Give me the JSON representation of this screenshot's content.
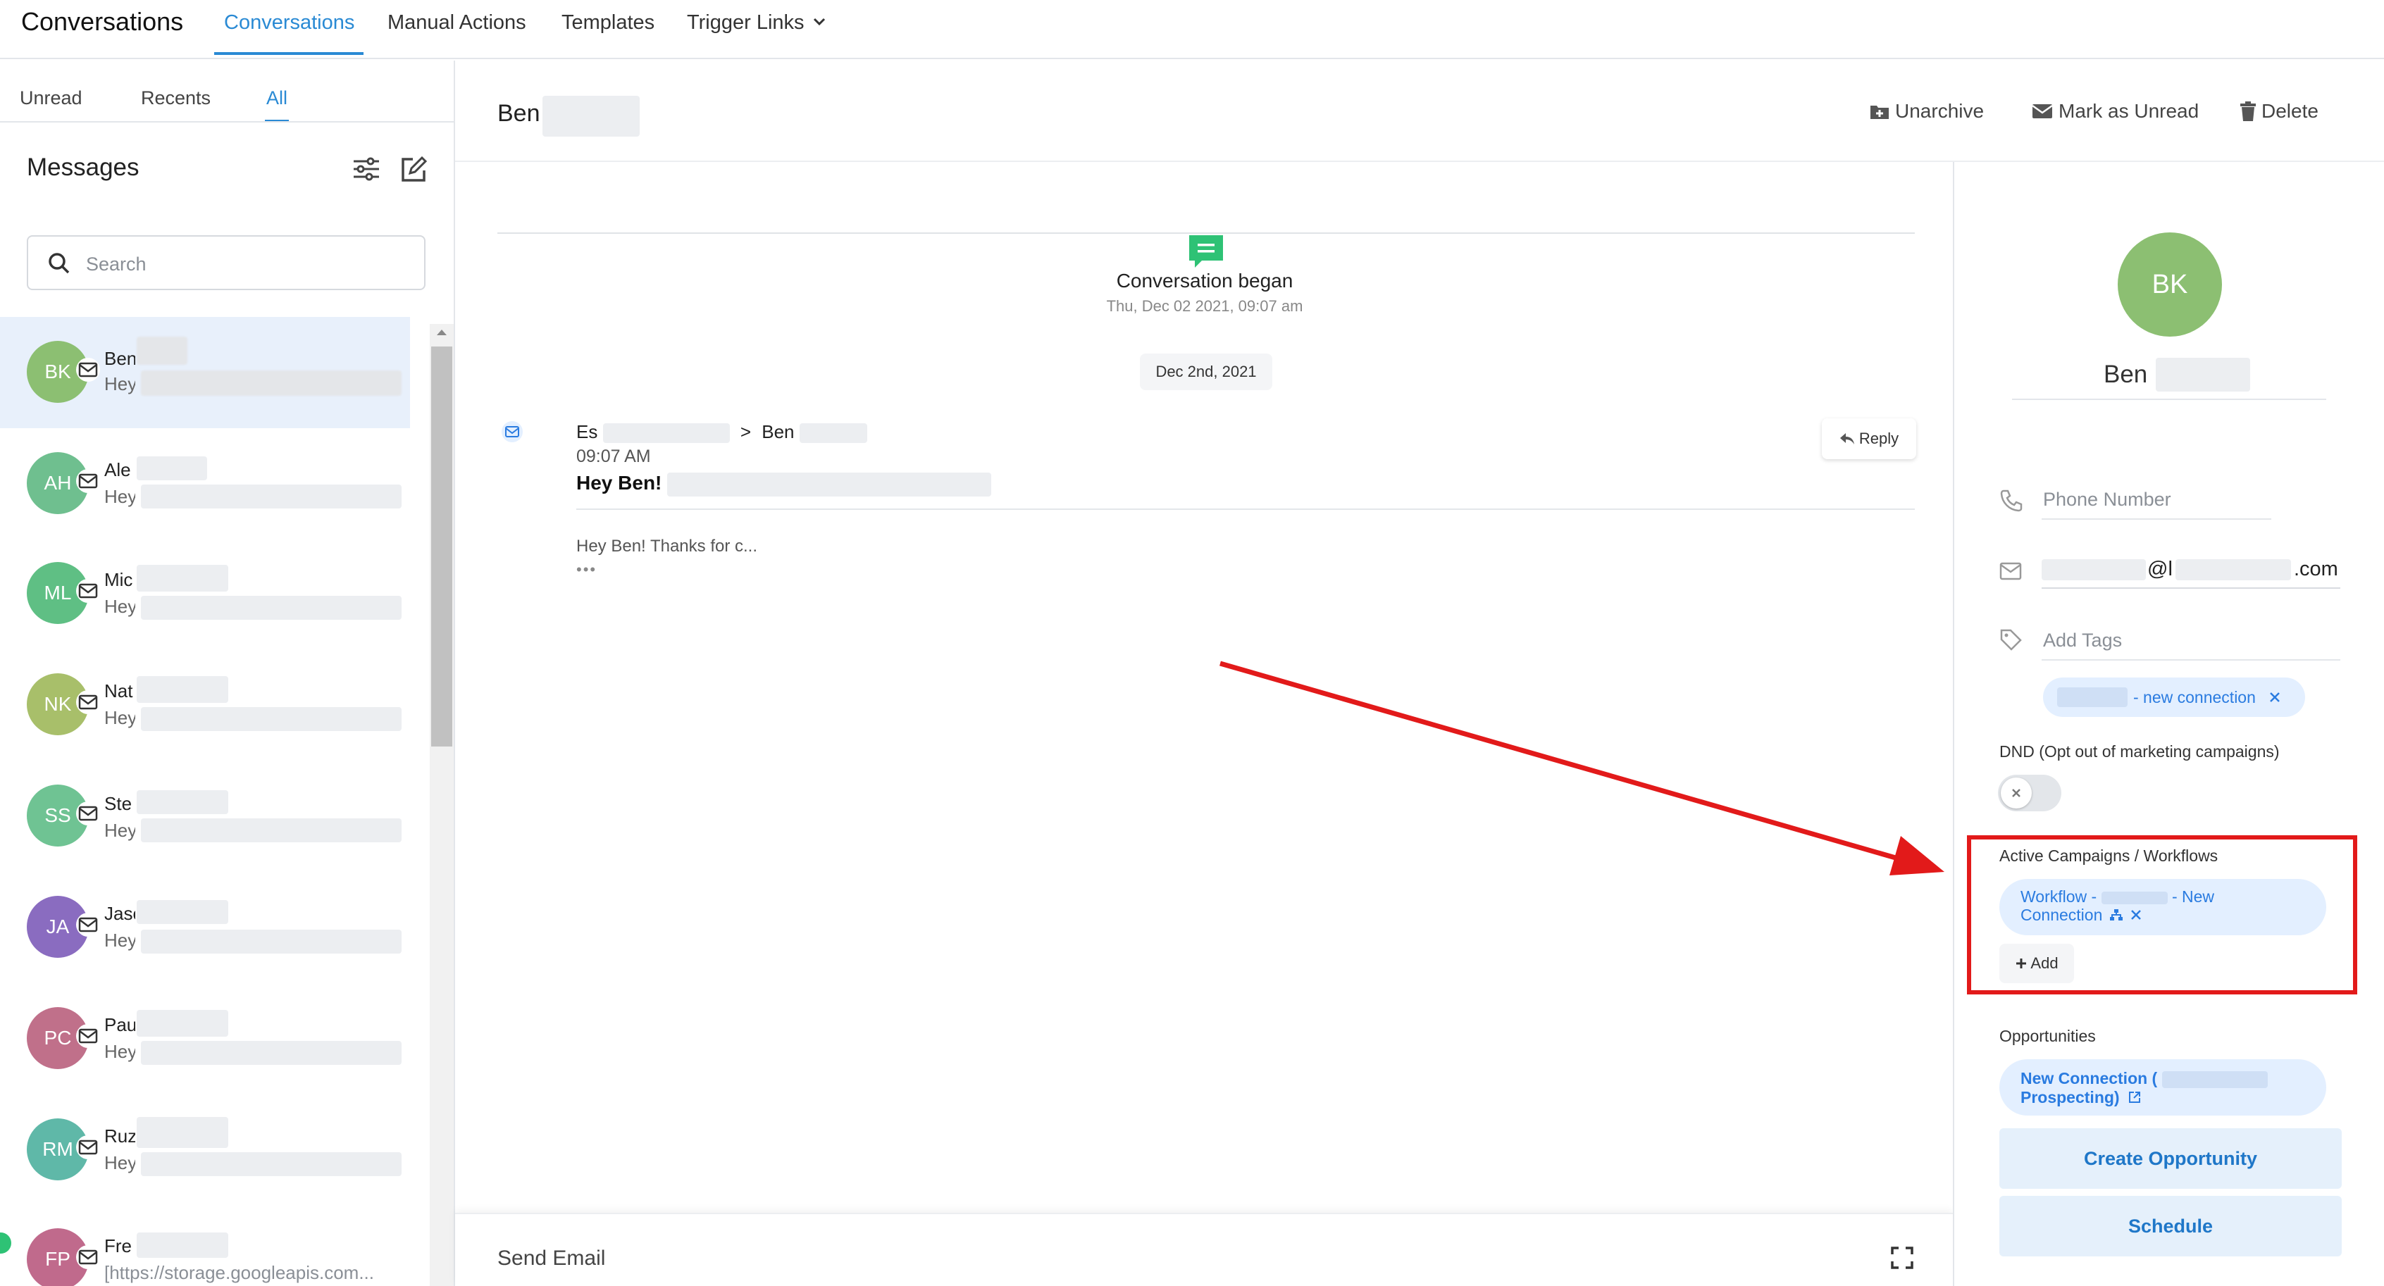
{
  "top_nav": {
    "app_title": "Conversations",
    "items": [
      "Conversations",
      "Manual Actions",
      "Templates",
      "Trigger Links"
    ]
  },
  "left_panel": {
    "tabs": [
      "Unread",
      "Recents",
      "All"
    ],
    "messages_title": "Messages",
    "search_placeholder": "Search",
    "conversations": [
      {
        "initials": "BK",
        "name": "Ben",
        "preview": "Hey",
        "color": "#8cbf72"
      },
      {
        "initials": "AH",
        "name": "Ale",
        "preview": "Hey",
        "color": "#6fbf8f"
      },
      {
        "initials": "ML",
        "name": "Mic",
        "preview": "Hey",
        "color": "#5fbf84"
      },
      {
        "initials": "NK",
        "name": "Nat",
        "preview": "Hey",
        "color": "#a8bf6a"
      },
      {
        "initials": "SS",
        "name": "Ste",
        "preview": "Hey",
        "color": "#6fc393"
      },
      {
        "initials": "JA",
        "name": "Jasc",
        "preview": "Hey",
        "color": "#8a6cc0"
      },
      {
        "initials": "PC",
        "name": "Pau",
        "preview": "Hey",
        "color": "#c0708a"
      },
      {
        "initials": "RM",
        "name": "Ruz",
        "preview": "Hey",
        "color": "#5fb8a8"
      },
      {
        "initials": "FP",
        "name": "Fre",
        "preview": "[https://storage.googleapis.com...",
        "color": "#c06a8c"
      }
    ]
  },
  "conversation": {
    "contact_first_name": "Ben",
    "actions": {
      "unarchive": "Unarchive",
      "mark_unread": "Mark as Unread",
      "delete": "Delete"
    },
    "began_label": "Conversation began",
    "began_date": "Thu, Dec 02 2021, 09:07 am",
    "date_chip": "Dec 2nd, 2021",
    "message": {
      "from_prefix": "Es",
      "arrow": ">",
      "to_name": "Ben",
      "time": "09:07 AM",
      "subject": "Hey Ben!",
      "body_preview": "Hey Ben! Thanks for c...",
      "more": "•••",
      "reply_label": "Reply"
    },
    "compose_label": "Send Email"
  },
  "contact_panel": {
    "avatar_initials": "BK",
    "name": "Ben",
    "phone_placeholder": "Phone Number",
    "email_at": "@l",
    "email_domain": ".com",
    "tags_placeholder": "Add Tags",
    "tag_label": "- new connection",
    "dnd_label": "DND (Opt out of marketing campaigns)",
    "campaigns_label": "Active Campaigns / Workflows",
    "workflow_line1_prefix": "Workflow -",
    "workflow_line1_suffix": "- New",
    "workflow_line2": "Connection",
    "add_label": "Add",
    "opportunities_label": "Opportunities",
    "opportunity_line1": "New Connection (",
    "opportunity_line2": "Prospecting)",
    "create_opportunity": "Create Opportunity",
    "schedule": "Schedule"
  },
  "colors": {
    "accent": "#2a8ad4",
    "highlight_red": "#e21a1a",
    "chip_bg": "#e3efff",
    "conversation_icon": "#2ec275"
  }
}
